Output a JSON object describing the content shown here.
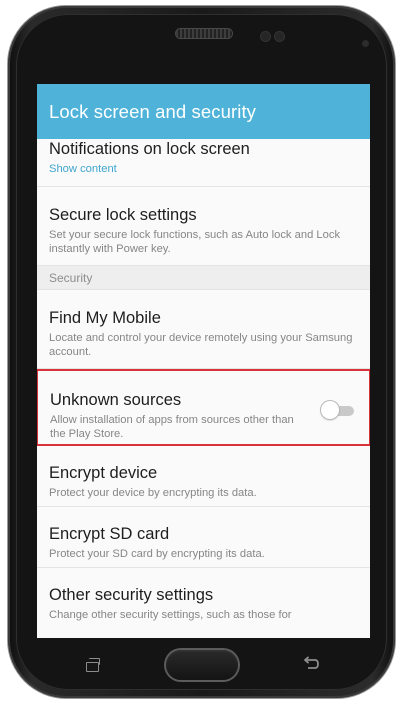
{
  "app_bar": {
    "title": "Lock screen and security"
  },
  "settings": {
    "notifications": {
      "label": "Notifications on lock screen",
      "sub": "Show content"
    },
    "secure_lock": {
      "label": "Secure lock settings",
      "sub": "Set your secure lock functions, such as Auto lock and Lock instantly with Power key."
    },
    "section_security": "Security",
    "find_my_mobile": {
      "label": "Find My Mobile",
      "sub": "Locate and control your device remotely using your Samsung account."
    },
    "unknown_sources": {
      "label": "Unknown sources",
      "sub": "Allow installation of apps from sources other than the Play Store.",
      "toggle_on": false
    },
    "encrypt_device": {
      "label": "Encrypt device",
      "sub": "Protect your device by encrypting its data."
    },
    "encrypt_sd": {
      "label": "Encrypt SD card",
      "sub": "Protect your SD card by encrypting its data."
    },
    "other_security": {
      "label": "Other security settings",
      "sub": "Change other security settings, such as those for"
    }
  },
  "colors": {
    "app_bar": "#4fb3d9",
    "link": "#3fa6cf",
    "highlight_border": "#d8323b"
  },
  "icons": {
    "recent_apps": "recent-apps-icon",
    "home": "home-button",
    "back": "back-icon"
  }
}
